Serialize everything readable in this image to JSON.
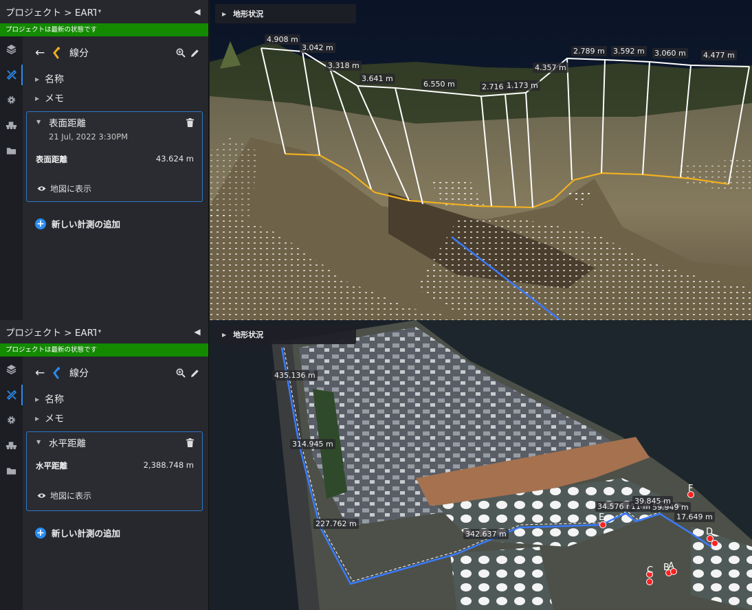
{
  "top": {
    "header": {
      "title": "プロジェクト > EARTHBRAIN__MIHA...",
      "dropdown": "▾",
      "collapse": "◀"
    },
    "status": "プロジェクトは最新の状態です",
    "toolbar": {
      "back": "←",
      "title": "線分"
    },
    "sections": {
      "name": "名称",
      "memo": "メモ"
    },
    "measurement": {
      "name": "表面距離",
      "date": "21 Jul, 2022 3:30PM",
      "label": "表面距離",
      "value": "43.624 m",
      "show_on_map": "地図に表示"
    },
    "add_label": "新しい計測の追加",
    "terrain_label": "地形状況",
    "segment_labels": [
      "4.908 m",
      "3.042 m",
      "3.318 m",
      "3.641 m",
      "6.550 m",
      "2.716 m",
      "1.173 m",
      "4.357 m",
      "2.789 m",
      "3.592 m",
      "3.060 m",
      "4.477 m"
    ]
  },
  "bottom": {
    "header": {
      "title": "プロジェクト > EARTHBRAIN__MIHA...",
      "dropdown": "▾",
      "collapse": "◀"
    },
    "status": "プロジェクトは最新の状態です",
    "toolbar": {
      "back": "←",
      "title": "線分"
    },
    "sections": {
      "name": "名称",
      "memo": "メモ"
    },
    "measurement": {
      "name": "水平距離",
      "label": "水平距離",
      "value": "2,388.748 m",
      "show_on_map": "地図に表示"
    },
    "add_label": "新しい計測の追加",
    "terrain_label": "地形状況",
    "distance_labels": [
      "435.136 m",
      "314.945 m",
      "227.762 m",
      "342.637 m",
      "34.576 m",
      "11 m",
      "59.949 m",
      "17.649 m",
      "39.845 m"
    ],
    "point_letters": [
      "E",
      "F",
      "A",
      "B",
      "C",
      "D"
    ]
  },
  "colors": {
    "accent": "#2a8cf0",
    "status_green": "#138a00",
    "surface_line": "#f0b020",
    "horizontal_line": "#3a7bff"
  },
  "icons": [
    "layers-icon",
    "measure-tool-icon",
    "settings-gear-icon",
    "machine-icon",
    "folder-icon",
    "zoom-icon",
    "edit-pencil-icon",
    "trash-icon",
    "eye-icon",
    "plus-circle-icon"
  ]
}
